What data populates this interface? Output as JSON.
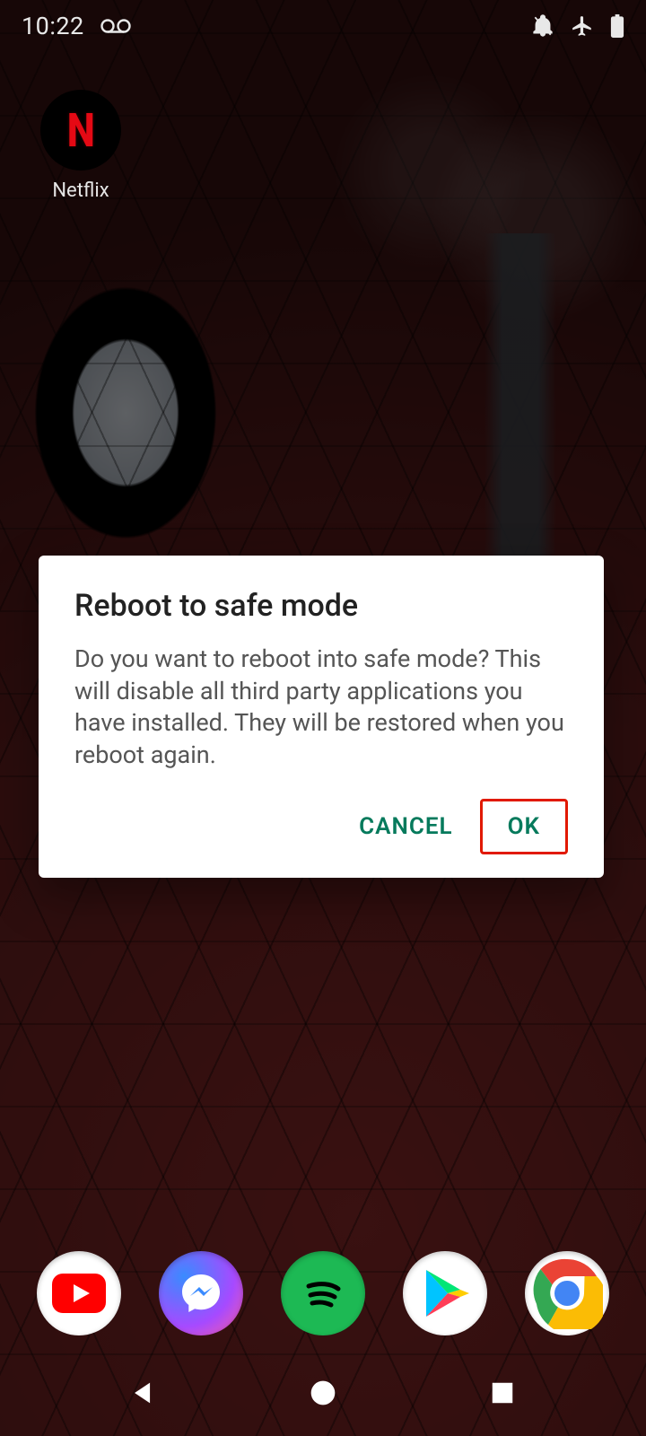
{
  "status_bar": {
    "time": "10:22",
    "left_icons": [
      "voicemail-icon"
    ],
    "right_icons": [
      "notifications-off-icon",
      "airplane-mode-icon",
      "battery-icon"
    ]
  },
  "home": {
    "apps": [
      {
        "name": "Netflix",
        "glyph": "N"
      }
    ]
  },
  "dock": {
    "items": [
      "youtube",
      "messenger",
      "spotify",
      "play-store",
      "chrome"
    ]
  },
  "dialog": {
    "title": "Reboot to safe mode",
    "body": "Do you want to reboot into safe mode? This will disable all third party applications you have installed. They will be restored when you reboot again.",
    "cancel_label": "CANCEL",
    "ok_label": "OK"
  },
  "colors": {
    "accent": "#067a5c",
    "highlight": "#e11900"
  }
}
